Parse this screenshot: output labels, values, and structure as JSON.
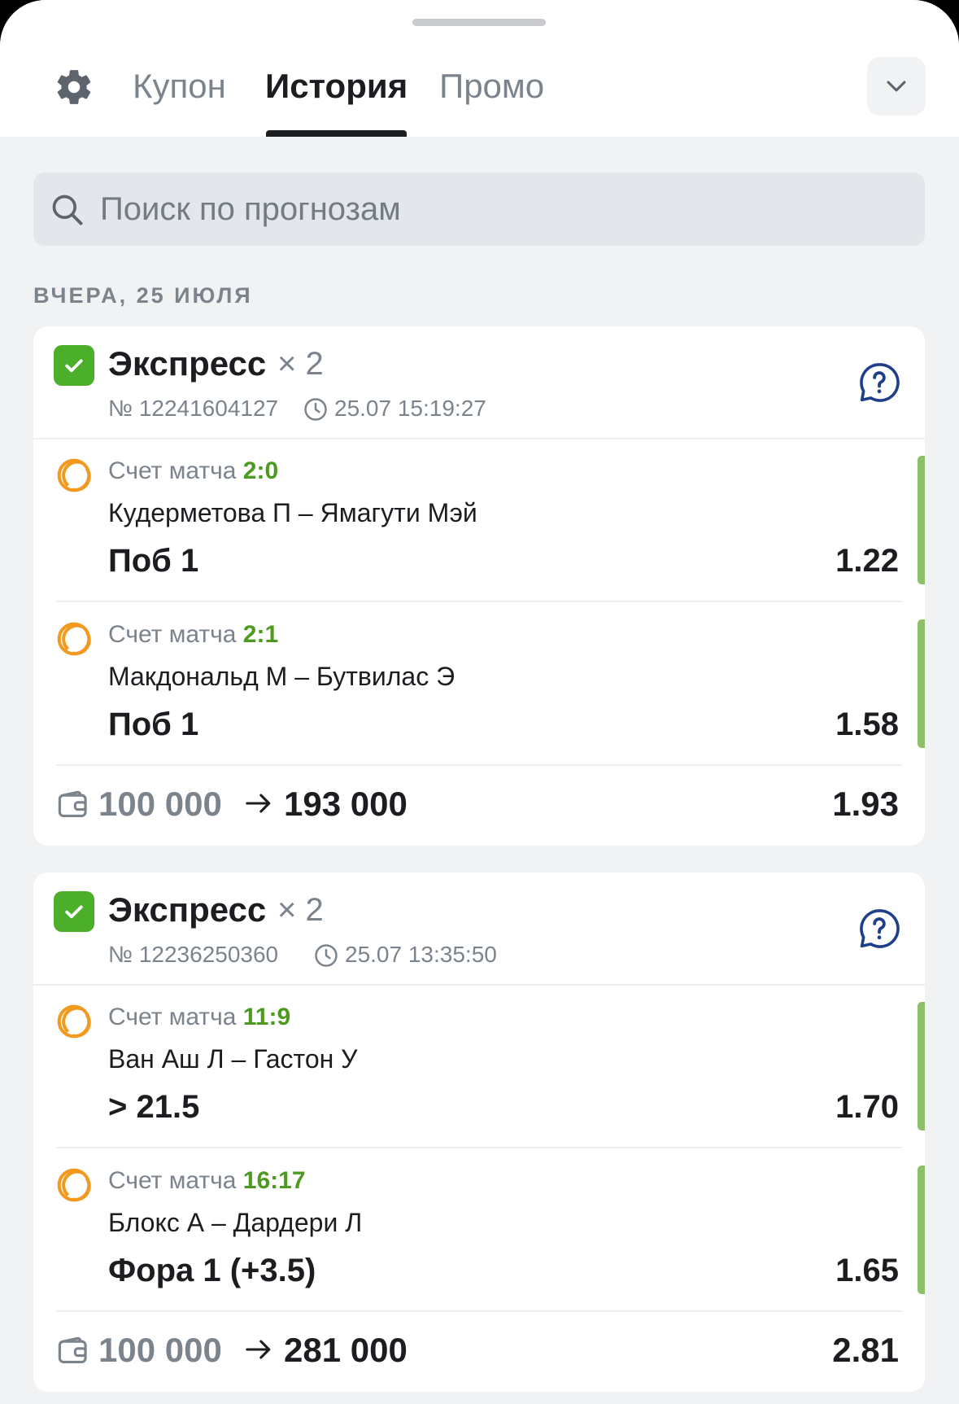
{
  "tabs": {
    "coupon": "Купон",
    "history": "История",
    "promo": "Промо"
  },
  "search": {
    "placeholder": "Поиск по прогнозам"
  },
  "date_header": "ВЧЕРА, 25 ИЮЛЯ",
  "colors": {
    "accent_green": "#4caf2a",
    "score_green": "#4c9a1f",
    "win_bar": "#8ec06a",
    "sport_orange": "#f29a1f",
    "help_blue": "#1f3f8a"
  },
  "bets": [
    {
      "type": "Экспресс",
      "multiplier": "× 2",
      "number": "№ 12241604127",
      "time": "25.07 15:19:27",
      "events": [
        {
          "score_label": "Счет матча",
          "score": "2:0",
          "teams": "Кудерметова П – Ямагути Мэй",
          "bet": "Поб 1",
          "odds": "1.22"
        },
        {
          "score_label": "Счет матча",
          "score": "2:1",
          "teams": "Макдональд М – Бутвилас Э",
          "bet": "Поб 1",
          "odds": "1.58"
        }
      ],
      "stake": "100 000",
      "payout": "193 000",
      "total_odds": "1.93"
    },
    {
      "type": "Экспресс",
      "multiplier": "× 2",
      "number": "№ 12236250360",
      "time": "25.07 13:35:50",
      "events": [
        {
          "score_label": "Счет матча",
          "score": "11:9",
          "teams": "Ван Аш Л – Гастон У",
          "bet": "> 21.5",
          "odds": "1.70"
        },
        {
          "score_label": "Счет матча",
          "score": "16:17",
          "teams": "Блокс А – Дардери Л",
          "bet": "Фора 1 (+3.5)",
          "odds": "1.65"
        }
      ],
      "stake": "100 000",
      "payout": "281 000",
      "total_odds": "2.81"
    }
  ]
}
